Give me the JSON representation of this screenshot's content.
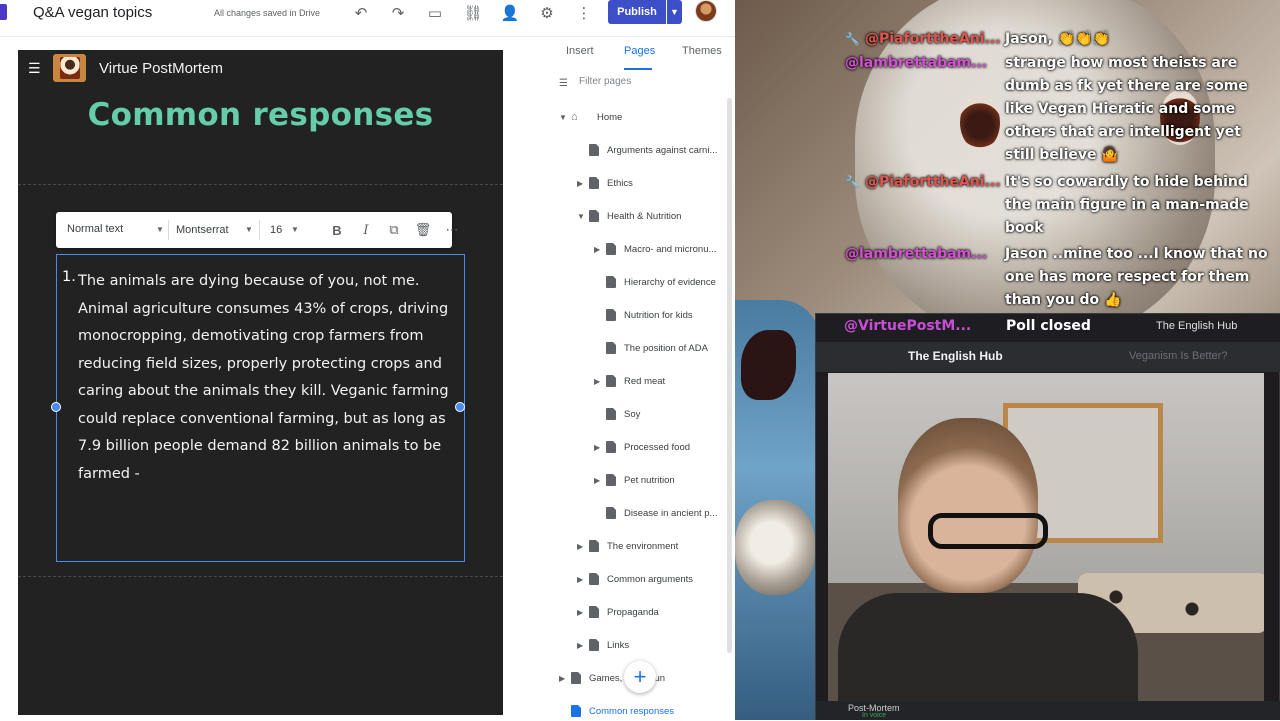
{
  "topbar": {
    "doc_title": "Q&A vegan topics",
    "saved_status": "All changes saved in Drive",
    "publish_label": "Publish",
    "icons": [
      "undo-icon",
      "redo-icon",
      "preview-icon",
      "link-icon",
      "share-icon",
      "settings-icon",
      "more-icon"
    ]
  },
  "site": {
    "name": "Virtue PostMortem",
    "page_heading": "Common responses"
  },
  "format_toolbar": {
    "style": "Normal text",
    "font": "Montserrat",
    "size": "16"
  },
  "textbox": {
    "list_number": "1.",
    "content": "The animals are dying because of you, not me. Animal agriculture consumes 43% of crops, driving monocropping, demotivating crop farmers from reducing field sizes, properly protecting crops and caring about the animals they kill. Veganic farming could replace conventional farming, but as long as 7.9 billion people demand 82 billion animals to be farmed -"
  },
  "side_panel": {
    "tabs": [
      {
        "label": "Insert",
        "active": false
      },
      {
        "label": "Pages",
        "active": true
      },
      {
        "label": "Themes",
        "active": false
      }
    ],
    "filter_placeholder": "Filter pages",
    "pages": [
      {
        "label": "Home",
        "level": 0,
        "expandable": true,
        "expanded": true,
        "home": true
      },
      {
        "label": "Arguments against carni...",
        "level": 1,
        "expandable": false
      },
      {
        "label": "Ethics",
        "level": 1,
        "expandable": true
      },
      {
        "label": "Health & Nutrition",
        "level": 1,
        "expandable": true,
        "expanded": true
      },
      {
        "label": "Macro- and micronu...",
        "level": 2,
        "expandable": true
      },
      {
        "label": "Hierarchy of evidence",
        "level": 2,
        "expandable": false
      },
      {
        "label": "Nutrition for kids",
        "level": 2,
        "expandable": false
      },
      {
        "label": "The position of ADA",
        "level": 2,
        "expandable": false
      },
      {
        "label": "Red meat",
        "level": 2,
        "expandable": true
      },
      {
        "label": "Soy",
        "level": 2,
        "expandable": false
      },
      {
        "label": "Processed food",
        "level": 2,
        "expandable": true
      },
      {
        "label": "Pet nutrition",
        "level": 2,
        "expandable": true
      },
      {
        "label": "Disease in ancient p...",
        "level": 2,
        "expandable": false
      },
      {
        "label": "The environment",
        "level": 1,
        "expandable": true
      },
      {
        "label": "Common arguments",
        "level": 1,
        "expandable": true
      },
      {
        "label": "Propaganda",
        "level": 1,
        "expandable": true
      },
      {
        "label": "Links",
        "level": 1,
        "expandable": true
      },
      {
        "label": "Games, ... nd Fun",
        "level": 0,
        "expandable": true
      },
      {
        "label": "Common responses",
        "level": 0,
        "expandable": false,
        "current": true
      }
    ]
  },
  "stream": {
    "chat": [
      {
        "user": "@PiaforttheAni...",
        "message": "Jason, 👏👏👏"
      },
      {
        "user": "@lambrettabam...",
        "message": "strange how most theists are dumb as fk yet there are some like Vegan Hieratic and some others that are intelligent yet still believe 🤷"
      },
      {
        "user": "@PiaforttheAni...",
        "message": "It's so cowardly to hide behind the main figure in a man-made book"
      },
      {
        "user": "@lambrettabam...",
        "message": "Jason ..mine too ...I know that no one has more respect for them than you do 👍"
      }
    ],
    "poll_user": "@VirtuePostM...",
    "poll_text": "Poll closed",
    "hub_label": "The English Hub",
    "discord_server": "The English Hub",
    "discord_channel": "Veganism Is Better?",
    "voice_user": "Post-Mortem",
    "voice_status": "In voice"
  }
}
